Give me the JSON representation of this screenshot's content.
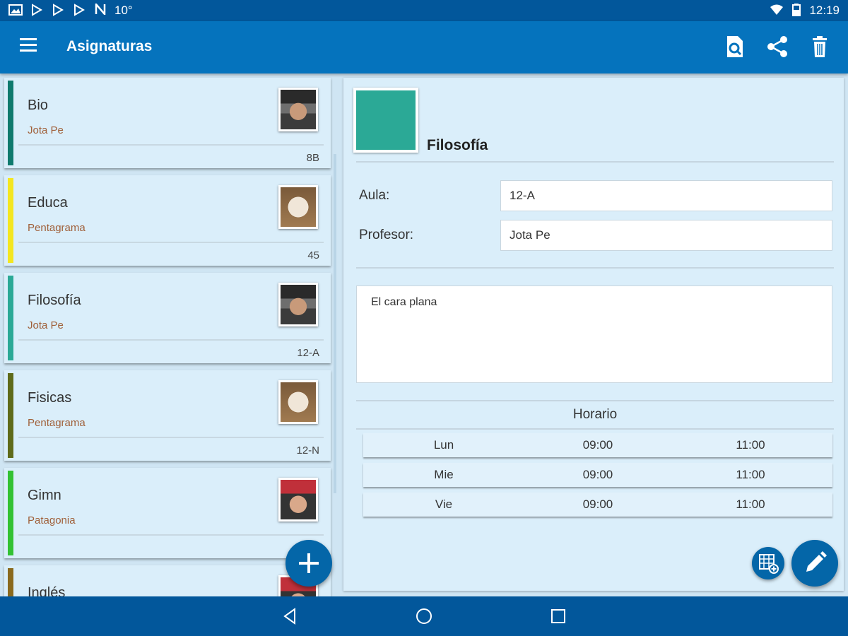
{
  "status_bar": {
    "notification_icons": [
      "image-icon",
      "play-store-icon",
      "play-store-icon",
      "play-store-icon",
      "n-icon"
    ],
    "temperature": "10°",
    "time": "12:19"
  },
  "app_bar": {
    "title": "Asignaturas",
    "actions": [
      "search-document-icon",
      "share-icon",
      "delete-icon"
    ]
  },
  "subjects": [
    {
      "name": "Bio",
      "teacher": "Jota Pe",
      "room": "8B",
      "color": "#0f7a6d",
      "avatar": "man-cap"
    },
    {
      "name": "Educa",
      "teacher": "Pentagrama",
      "room": "45",
      "color": "#f4e620",
      "avatar": "dog"
    },
    {
      "name": "Filosofía",
      "teacher": "Jota Pe",
      "room": "12-A",
      "color": "#2ba996",
      "avatar": "man-cap"
    },
    {
      "name": "Fisicas",
      "teacher": "Pentagrama",
      "room": "12-N",
      "color": "#5f6b1a",
      "avatar": "dog"
    },
    {
      "name": "Gimn",
      "teacher": "Patagonia",
      "room": "",
      "color": "#33c233",
      "avatar": "man-red-cap"
    },
    {
      "name": "Inglés",
      "teacher": "",
      "room": "",
      "color": "#8a6a1e",
      "avatar": "man-red-cap"
    }
  ],
  "detail": {
    "color": "#2ba996",
    "title": "Filosofía",
    "aula_label": "Aula:",
    "aula_value": "12-A",
    "profesor_label": "Profesor:",
    "profesor_value": "Jota Pe",
    "notes": "El cara plana",
    "horario_title": "Horario",
    "schedule": [
      {
        "day": "Lun",
        "start": "09:00",
        "end": "11:00"
      },
      {
        "day": "Mie",
        "start": "09:00",
        "end": "11:00"
      },
      {
        "day": "Vie",
        "start": "09:00",
        "end": "11:00"
      }
    ]
  },
  "accent_color": "#0573bd"
}
